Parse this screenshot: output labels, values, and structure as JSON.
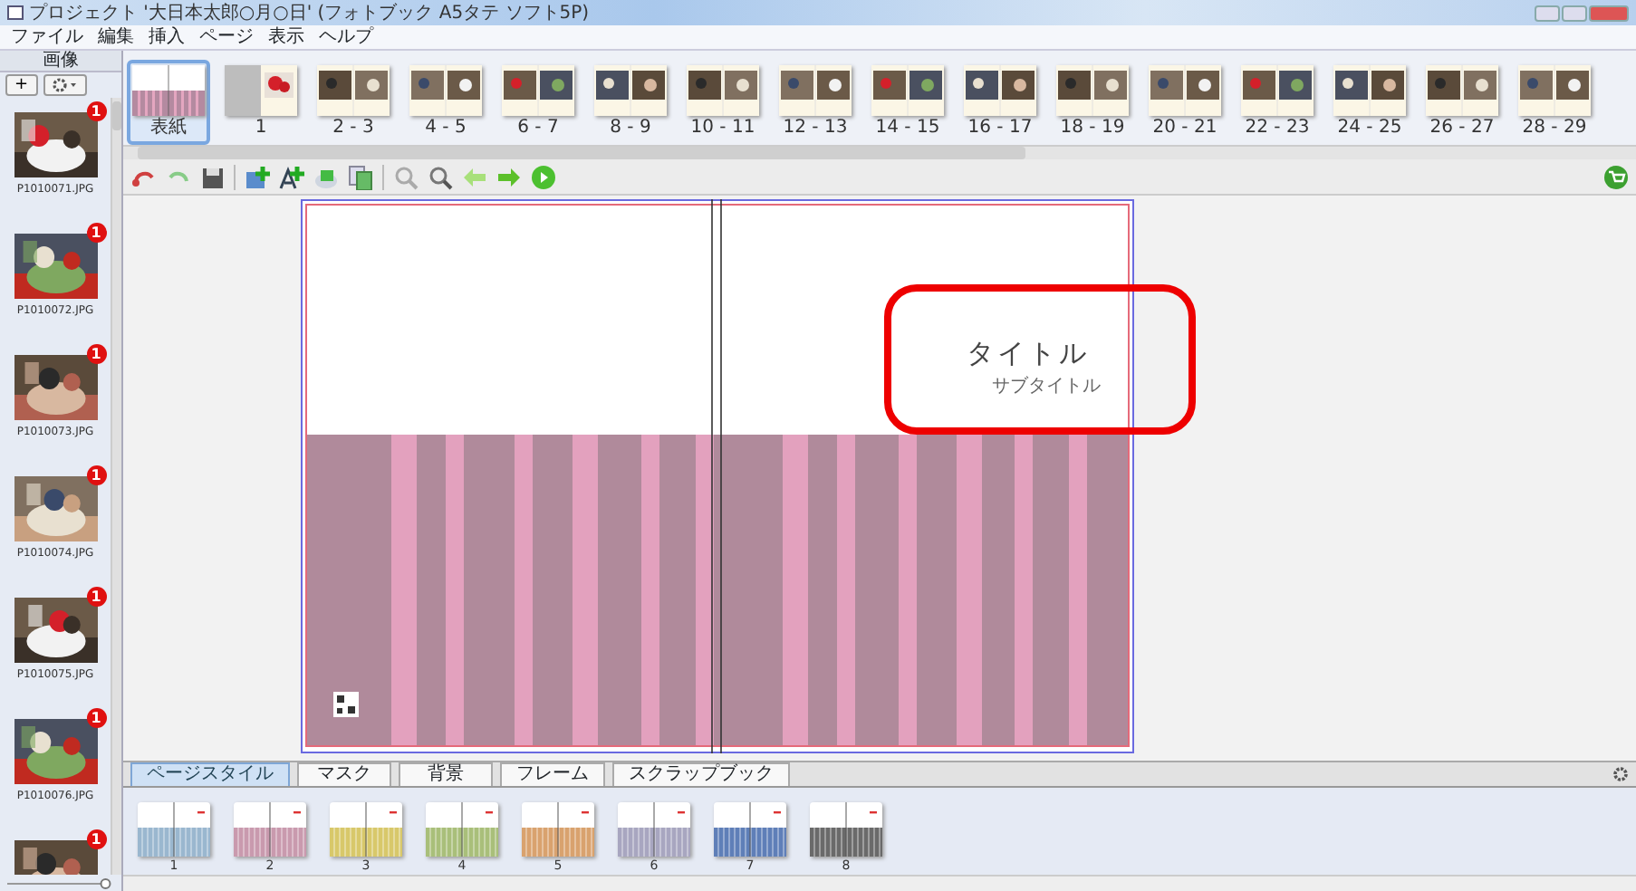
{
  "window": {
    "title": "プロジェクト '大日本太郎○月○日' (フォトブック A5タテ ソフト5P)"
  },
  "menu": [
    "ファイル",
    "編集",
    "挿入",
    "ページ",
    "表示",
    "ヘルプ"
  ],
  "image_panel": {
    "title": "画像",
    "add_button": "+",
    "photos": [
      {
        "name": "P1010071.JPG",
        "badge": "1"
      },
      {
        "name": "P1010072.JPG",
        "badge": "1"
      },
      {
        "name": "P1010073.JPG",
        "badge": "1"
      },
      {
        "name": "P1010074.JPG",
        "badge": "1"
      },
      {
        "name": "P1010075.JPG",
        "badge": "1"
      },
      {
        "name": "P1010076.JPG",
        "badge": "1"
      },
      {
        "badge": "1"
      }
    ],
    "zoom_slider": {
      "level": 0.95
    }
  },
  "pages": [
    {
      "label": "表紙",
      "kind": "cover",
      "selected": true
    },
    {
      "label": "1",
      "kind": "single",
      "selected": false
    },
    {
      "label": "2 - 3",
      "kind": "spread",
      "selected": false
    },
    {
      "label": "4 - 5",
      "kind": "spread",
      "selected": false
    },
    {
      "label": "6 - 7",
      "kind": "spread",
      "selected": false
    },
    {
      "label": "8 - 9",
      "kind": "spread",
      "selected": false
    },
    {
      "label": "10 - 11",
      "kind": "spread",
      "selected": false
    },
    {
      "label": "12 - 13",
      "kind": "spread",
      "selected": false
    },
    {
      "label": "14 - 15",
      "kind": "spread",
      "selected": false
    },
    {
      "label": "16 - 17",
      "kind": "spread",
      "selected": false
    },
    {
      "label": "18 - 19",
      "kind": "spread",
      "selected": false
    },
    {
      "label": "20 - 21",
      "kind": "spread",
      "selected": false
    },
    {
      "label": "22 - 23",
      "kind": "spread",
      "selected": false
    },
    {
      "label": "24 - 25",
      "kind": "spread",
      "selected": false
    },
    {
      "label": "26 - 27",
      "kind": "spread",
      "selected": false
    },
    {
      "label": "28 - 29",
      "kind": "spread",
      "selected": false
    }
  ],
  "cover": {
    "title": "タイトル",
    "subtitle": "サブタイトル"
  },
  "tabs": [
    {
      "label": "ページスタイル",
      "selected": true
    },
    {
      "label": "マスク",
      "selected": false
    },
    {
      "label": "背景",
      "selected": false
    },
    {
      "label": "フレーム",
      "selected": false
    },
    {
      "label": "スクラップブック",
      "selected": false
    }
  ],
  "styles": [
    {
      "label": "1",
      "color": "#9ab7cf"
    },
    {
      "label": "2",
      "color": "#c99aae"
    },
    {
      "label": "3",
      "color": "#d8c86a"
    },
    {
      "label": "4",
      "color": "#a9bf7a"
    },
    {
      "label": "5",
      "color": "#d9a26e"
    },
    {
      "label": "6",
      "color": "#a8a6c0"
    },
    {
      "label": "7",
      "color": "#5f7fb8"
    },
    {
      "label": "8",
      "color": "#6a6a6a"
    }
  ]
}
